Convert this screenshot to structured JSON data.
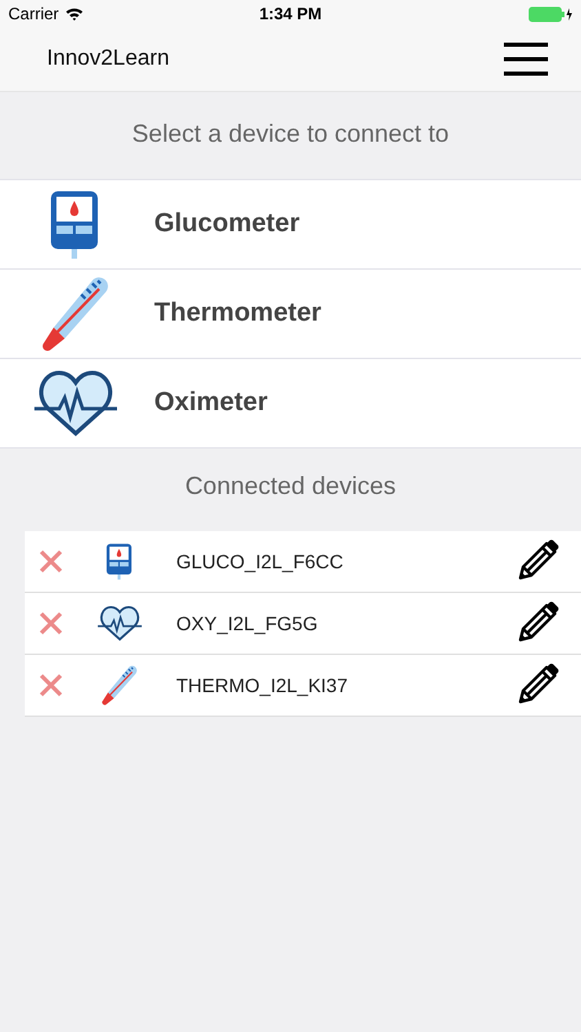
{
  "status_bar": {
    "carrier": "Carrier",
    "time": "1:34 PM"
  },
  "nav": {
    "title": "Innov2Learn"
  },
  "select_section": {
    "heading": "Select a device to connect to",
    "devices": [
      {
        "kind": "glucometer",
        "label": "Glucometer"
      },
      {
        "kind": "thermometer",
        "label": "Thermometer"
      },
      {
        "kind": "oximeter",
        "label": "Oximeter"
      }
    ]
  },
  "connected_section": {
    "heading": "Connected devices",
    "devices": [
      {
        "kind": "glucometer",
        "name": "GLUCO_I2L_F6CC"
      },
      {
        "kind": "oximeter",
        "name": "OXY_I2L_FG5G"
      },
      {
        "kind": "thermometer",
        "name": "THERMO_I2L_KI37"
      }
    ]
  }
}
